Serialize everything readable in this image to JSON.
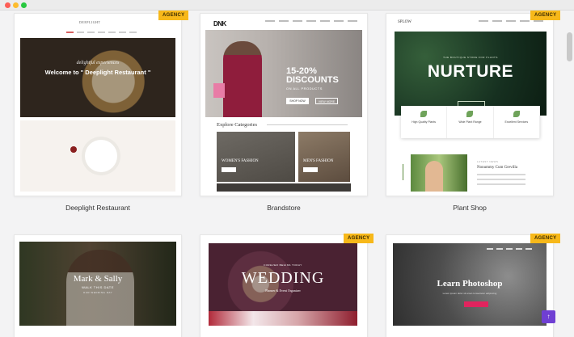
{
  "cards": [
    {
      "title": "Deeplight Restaurant",
      "badge": "AGENCY",
      "logo": "DEEPLIGHT",
      "hero_script": "delightful experiences",
      "hero_text": "Welcome to \" Deeplight Restaurant \""
    },
    {
      "title": "Brandstore",
      "logo": "DNK",
      "offer_line1": "15-20%",
      "offer_line2": "DISCOUNTS",
      "offer_sub": "ON ALL PRODUCTS",
      "btn1": "SHOP NOW",
      "btn2": "VIEW MORE",
      "explore": "Explore Categories",
      "cat_women": "WOMEN'S FASHION",
      "cat_men": "MEN'S FASHION"
    },
    {
      "title": "Plant Shop",
      "badge": "AGENCY",
      "logo": "SPLOW",
      "eyebrow": "THE BOUTIQUE STORE FOR PLANTS",
      "hero_title": "NURTURE",
      "features": [
        "High Quality Plants",
        "Wide Plant Range",
        "Excellent Services"
      ],
      "blog_eyebrow": "LATEST NEWS",
      "blog_title": "Nonummy Cum Grevilla"
    },
    {
      "title": "",
      "hero_title": "Mark & Sally",
      "hero_sub": "WALK THIS DATE",
      "hero_sub2": "OUR WEDDING DAY"
    },
    {
      "title": "",
      "badge": "AGENCY",
      "eyebrow": "FOREVER BEGINS TODAY",
      "hero_title": "WEDDING",
      "hero_sub": "Planner & Event Organizer"
    },
    {
      "title": "",
      "badge": "AGENCY",
      "hero_title": "Learn Photoshop",
      "hero_sub": "Lorem ipsum dolor sit amet consectetur adipiscing"
    }
  ],
  "fab_icon": "up-arrow-icon",
  "colors": {
    "badge": "#f7b81a",
    "fab": "#6f3fd3",
    "accent_pink": "#e0245e"
  }
}
